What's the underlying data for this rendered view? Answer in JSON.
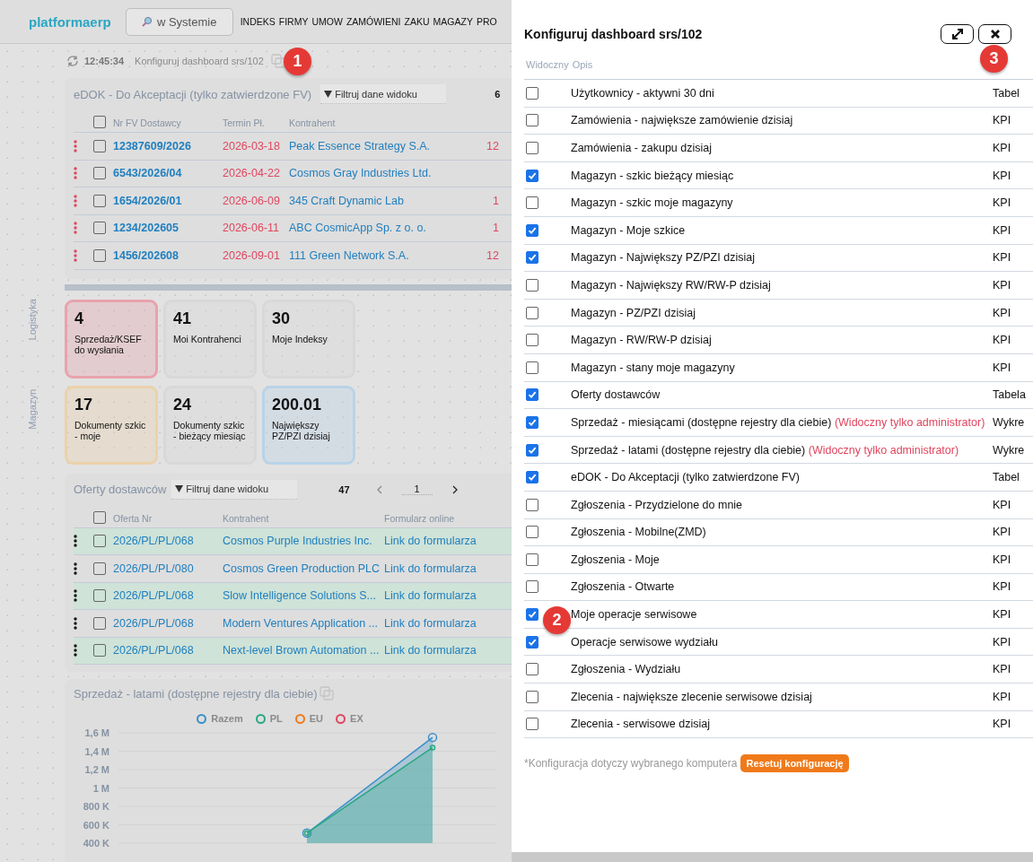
{
  "header": {
    "logo": "platformaerp",
    "search_button": "w Systemie",
    "nav": [
      "INDEKS",
      "FIRMY",
      "UMOW",
      "ZAMÓWIENI",
      "ZAKU",
      "MAGAZY",
      "PRO"
    ]
  },
  "toolbar": {
    "time": "12:45:34",
    "config_link": "Konfiguruj dashboard srs/102"
  },
  "side_labels": [
    "Logistyka",
    "Magazyn"
  ],
  "edok": {
    "title": "eDOK - Do Akceptacji (tylko zatwierdzone FV)",
    "filter_placeholder": "Filtruj dane widoku",
    "count": "6",
    "columns": [
      "Nr FV Dostawcy",
      "Termin Pł.",
      "Kontrahent"
    ],
    "select_all_checked": false,
    "rows": [
      {
        "number": "12387609/2026",
        "due": "2026-03-18",
        "contractor": "Peak Essence Strategy S.A.",
        "column_4": "12",
        "checked": false
      },
      {
        "number": "6543/2026/04",
        "due": "2026-04-22",
        "contractor": "Cosmos Gray Industries Ltd.",
        "checked": false
      },
      {
        "number": "1654/2026/01",
        "due": "2026-06-09",
        "contractor": "345 Craft Dynamic Lab",
        "column_4": "1",
        "checked": false
      },
      {
        "number": "1234/202605",
        "due": "2026-06-11",
        "contractor": "ABC CosmicApp Sp. z o. o.",
        "column_4": "1",
        "checked": false
      },
      {
        "number": "1456/202608",
        "due": "2026-09-01",
        "contractor": "111 Green Network S.A.",
        "column_4": "12",
        "checked": false
      }
    ]
  },
  "kpis": [
    {
      "value": "4",
      "label": "Sprzedaż/KSEF do wysłania",
      "color": "#e8a3ad"
    },
    {
      "value": "41",
      "label": "Moi Kontrahenci",
      "color": "#d8d8d8"
    },
    {
      "value": "30",
      "label": "Moje Indeksy",
      "color": "#d8d8d8"
    },
    {
      "value": "17",
      "label": "Dokumenty szkic - moje",
      "color": "#ecd2aa"
    },
    {
      "value": "24",
      "label": "Dokumenty szkic - bieżący miesiąc",
      "color": "#d8d8d8"
    },
    {
      "value": "200.01",
      "label": "Największy PZ/PZI dzisiaj",
      "color": "#b9d3e8"
    }
  ],
  "offers": {
    "title": "Oferty dostawców",
    "filter_placeholder": "Filtruj dane widoku",
    "count": "47",
    "page": "1",
    "columns": [
      "Oferta Nr",
      "Kontrahent",
      "Formularz online"
    ],
    "select_all_checked": false,
    "rows": [
      {
        "number": "2026/PL/PL/068",
        "contractor": "Cosmos Purple Industries Inc.",
        "link": "Link do formularza",
        "highlighted": true,
        "checked": false
      },
      {
        "number": "2026/PL/PL/080",
        "contractor": "Cosmos Green Production PLC",
        "link": "Link do formularza",
        "highlighted": false,
        "checked": false
      },
      {
        "number": "2026/PL/PL/068",
        "contractor": "Slow Intelligence Solutions S...",
        "link": "Link do formularza",
        "highlighted": true,
        "checked": false
      },
      {
        "number": "2026/PL/PL/068",
        "contractor": "Modern Ventures Application ...",
        "link": "Link do formularza",
        "highlighted": false,
        "checked": false
      },
      {
        "number": "2026/PL/PL/068",
        "contractor": "Next-level Brown Automation ...",
        "link": "Link do formularza",
        "highlighted": true,
        "checked": false
      }
    ]
  },
  "sales_chart": {
    "title": "Sprzedaż - latami (dostępne rejestry dla ciebie)",
    "chart_data": {
      "type": "area",
      "grid": true,
      "ylim": [
        400000,
        1600000
      ],
      "yticks": [
        {
          "value": 400000,
          "label": "400 K"
        },
        {
          "value": 600000,
          "label": "600 K"
        },
        {
          "value": 800000,
          "label": "800 K"
        },
        {
          "value": 1000000,
          "label": "1 M"
        },
        {
          "value": 1200000,
          "label": "1,2 M"
        },
        {
          "value": 1400000,
          "label": "1,4 M"
        },
        {
          "value": 1600000,
          "label": "1,6 M"
        }
      ],
      "series": [
        {
          "name": "Razem",
          "color": "#3a8fc8",
          "values": [
            null,
            510000,
            1550000
          ]
        },
        {
          "name": "PL",
          "color": "#27a882",
          "values": [
            null,
            510000,
            1440000
          ]
        },
        {
          "name": "EU",
          "color": "#f07a1a",
          "values": [
            null,
            null,
            null
          ]
        },
        {
          "name": "EX",
          "color": "#e0455e",
          "values": [
            null,
            null,
            null
          ]
        }
      ]
    }
  },
  "modal": {
    "title": "Konfiguruj dashboard srs/102",
    "columns": [
      "Widoczny",
      "Opis"
    ],
    "rows": [
      {
        "label": "Użytkownicy - aktywni 30 dni",
        "type": "Tabel",
        "checked": false
      },
      {
        "label": "Zamówienia - największe zamówienie dzisiaj",
        "type": "KPI",
        "checked": false
      },
      {
        "label": "Zamówienia - zakupu dzisiaj",
        "type": "KPI",
        "checked": false
      },
      {
        "label": "Magazyn - szkic bieżący miesiąc",
        "type": "KPI",
        "checked": true
      },
      {
        "label": "Magazyn - szkic moje magazyny",
        "type": "KPI",
        "checked": false
      },
      {
        "label": "Magazyn - Moje szkice",
        "type": "KPI",
        "checked": true
      },
      {
        "label": "Magazyn - Największy PZ/PZI dzisiaj",
        "type": "KPI",
        "checked": true
      },
      {
        "label": "Magazyn - Największy RW/RW-P dzisiaj",
        "type": "KPI",
        "checked": false
      },
      {
        "label": "Magazyn - PZ/PZI dzisiaj",
        "type": "KPI",
        "checked": false
      },
      {
        "label": "Magazyn - RW/RW-P dzisiaj",
        "type": "KPI",
        "checked": false
      },
      {
        "label": "Magazyn - stany moje magazyny",
        "type": "KPI",
        "checked": false
      },
      {
        "label": "Oferty dostawców",
        "type": "Tabela",
        "checked": true
      },
      {
        "label": "Sprzedaż - miesiącami (dostępne rejestry dla ciebie)",
        "note": "(Widoczny tylko administrator)",
        "type": "Wykre",
        "checked": true
      },
      {
        "label": "Sprzedaż - latami (dostępne rejestry dla ciebie)",
        "note": "(Widoczny tylko administrator)",
        "type": "Wykre",
        "checked": true
      },
      {
        "label": "eDOK - Do Akceptacji (tylko zatwierdzone FV)",
        "type": "Tabel",
        "checked": true
      },
      {
        "label": "Zgłoszenia - Przydzielone do mnie",
        "type": "KPI",
        "checked": false
      },
      {
        "label": "Zgłoszenia - Mobilne(ZMD)",
        "type": "KPI",
        "checked": false
      },
      {
        "label": "Zgłoszenia - Moje",
        "type": "KPI",
        "checked": false
      },
      {
        "label": "Zgłoszenia - Otwarte",
        "type": "KPI",
        "checked": false
      },
      {
        "label": "Moje operacje serwisowe",
        "type": "KPI",
        "checked": true
      },
      {
        "label": "Operacje serwisowe wydziału",
        "type": "KPI",
        "checked": true
      },
      {
        "label": "Zgłoszenia - Wydziału",
        "type": "KPI",
        "checked": false
      },
      {
        "label": "Zlecenia - największe zlecenie serwisowe dzisiaj",
        "type": "KPI",
        "checked": false
      },
      {
        "label": "Zlecenia - serwisowe dzisiaj",
        "type": "KPI",
        "checked": false
      }
    ],
    "footnote": "*Konfiguracja dotyczy wybranego komputera",
    "reset_button": "Resetuj konfigurację"
  },
  "markers": [
    "1",
    "2",
    "3"
  ]
}
